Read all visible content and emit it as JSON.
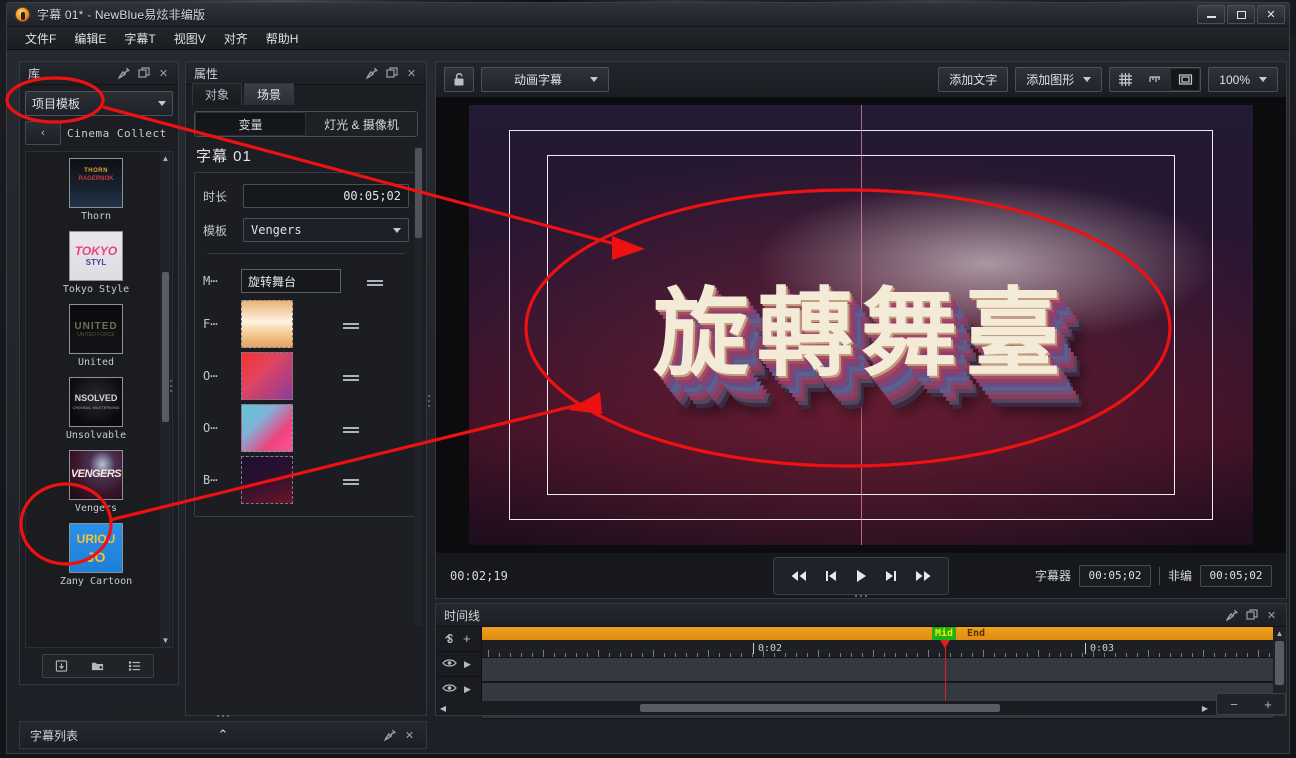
{
  "window": {
    "title": "字幕 01* - NewBlue易炫非编版",
    "minimize": "—",
    "maximize": "□",
    "close": "✕"
  },
  "menubar": {
    "items": [
      "文件F",
      "编辑E",
      "字幕T",
      "视图V",
      "对齐",
      "帮助H"
    ]
  },
  "library": {
    "title": "库",
    "category": "项目模板",
    "breadcrumb_back": "‹",
    "breadcrumb": "Cinema Collect",
    "items": [
      {
        "label": "Thorn"
      },
      {
        "label": "Tokyo Style"
      },
      {
        "label": "United"
      },
      {
        "label": "Unsolvable"
      },
      {
        "label": "Vengers"
      },
      {
        "label": "Zany Cartoon"
      }
    ],
    "tools": [
      "save-icon",
      "new-folder-icon",
      "list-view-icon"
    ]
  },
  "properties": {
    "title": "属性",
    "tabs": [
      {
        "label": "对象",
        "active": false
      },
      {
        "label": "场景",
        "active": true
      }
    ],
    "segments": [
      {
        "label": "变量",
        "active": true
      },
      {
        "label": "灯光 & 摄像机",
        "active": false
      }
    ],
    "heading": "字幕 01",
    "fields": [
      {
        "label": "时长",
        "value": "00:05;02"
      },
      {
        "label": "模板",
        "value": "Vengers"
      }
    ],
    "variables": [
      {
        "label": "M⋯",
        "type": "text",
        "value": "旋转舞台"
      },
      {
        "label": "F⋯",
        "type": "color",
        "color": "linear-gradient(180deg,#e9b478 0%,#fdf2e2 45%,#f6cb96 70%,#e2a461 100%)"
      },
      {
        "label": "O⋯",
        "type": "color",
        "color": "linear-gradient(135deg,#f4332e 0%,#e0445f 40%,#8b3d9b 100%)"
      },
      {
        "label": "O⋯",
        "type": "color",
        "color": "linear-gradient(135deg,#5fc8d8 0%,#7fb0d8 35%,#f2417d 70%,#f8569a 100%)"
      },
      {
        "label": "B⋯",
        "type": "color",
        "color": "linear-gradient(160deg,#1b1030 0%,#2a1030 45%,#6d1526 100%)"
      }
    ]
  },
  "preview": {
    "lock_icon": "lock-icon",
    "mode": "动画字幕",
    "add_text": "添加文字",
    "add_shape": "添加图形",
    "view_icons": [
      "grid-icon",
      "ruler-icon",
      "safe-area-icon"
    ],
    "zoom": "100%",
    "canvas_text": "旋轉舞臺",
    "current_time": "00:02;19",
    "transport": [
      "skip-back-icon",
      "prev-frame-icon",
      "play-icon",
      "next-frame-icon",
      "skip-forward-icon"
    ],
    "titler_label": "字幕器",
    "titler_time": "00:05;02",
    "editor_label": "非编",
    "editor_time": "00:05;02"
  },
  "timeline": {
    "title": "时间线",
    "markers": [
      {
        "label": "Mid",
        "kind": "mid"
      },
      {
        "label": "End",
        "kind": "end"
      }
    ],
    "ruler_labels": [
      "0:02",
      "0:03"
    ],
    "tracks": 3,
    "zoom_out": "−",
    "zoom_in": "+"
  },
  "subtitle_list": {
    "title": "字幕列表",
    "collapse": "⌃"
  },
  "colors": {
    "accent_orange": "#f0a020",
    "marker_green": "#17b317",
    "playhead_red": "#e02020",
    "annotation_red": "#ee1111",
    "panel_bg": "#1c1e23"
  }
}
